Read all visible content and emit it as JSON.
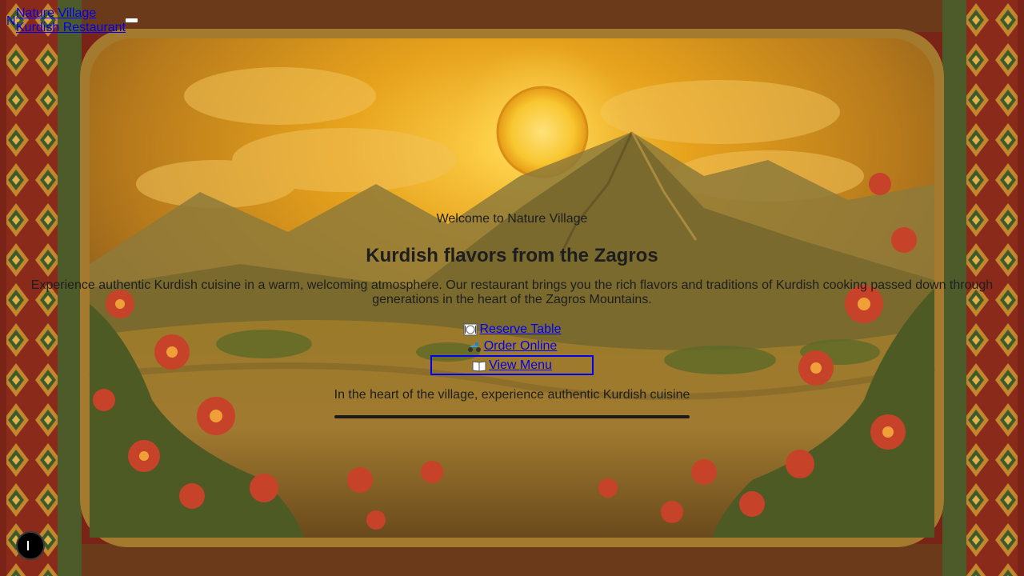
{
  "header": {
    "brand_line1": "Nature Village",
    "brand_line2": "Kurdish Restaurant",
    "brand_tiny": "N"
  },
  "hero": {
    "welcome": "Welcome to Nature Village",
    "headline": "Kurdish flavors from the Zagros",
    "description": "Experience authentic Kurdish cuisine in a warm, welcoming atmosphere. Our restaurant brings you the rich flavors and traditions of Kurdish cooking passed down through generations in the heart of the Zagros Mountains.",
    "tagline": "In the heart of the village, experience authentic Kurdish cuisine"
  },
  "cta": {
    "reserve": {
      "label": "Reserve Table",
      "icon": "plate-cutlery-icon"
    },
    "order": {
      "label": "Order Online",
      "icon": "scooter-icon"
    },
    "menu": {
      "label": "View Menu",
      "icon": "open-book-icon"
    }
  },
  "colors": {
    "link": "#0000ee",
    "border_red": "#7a2418",
    "sun": "#f4b821"
  }
}
